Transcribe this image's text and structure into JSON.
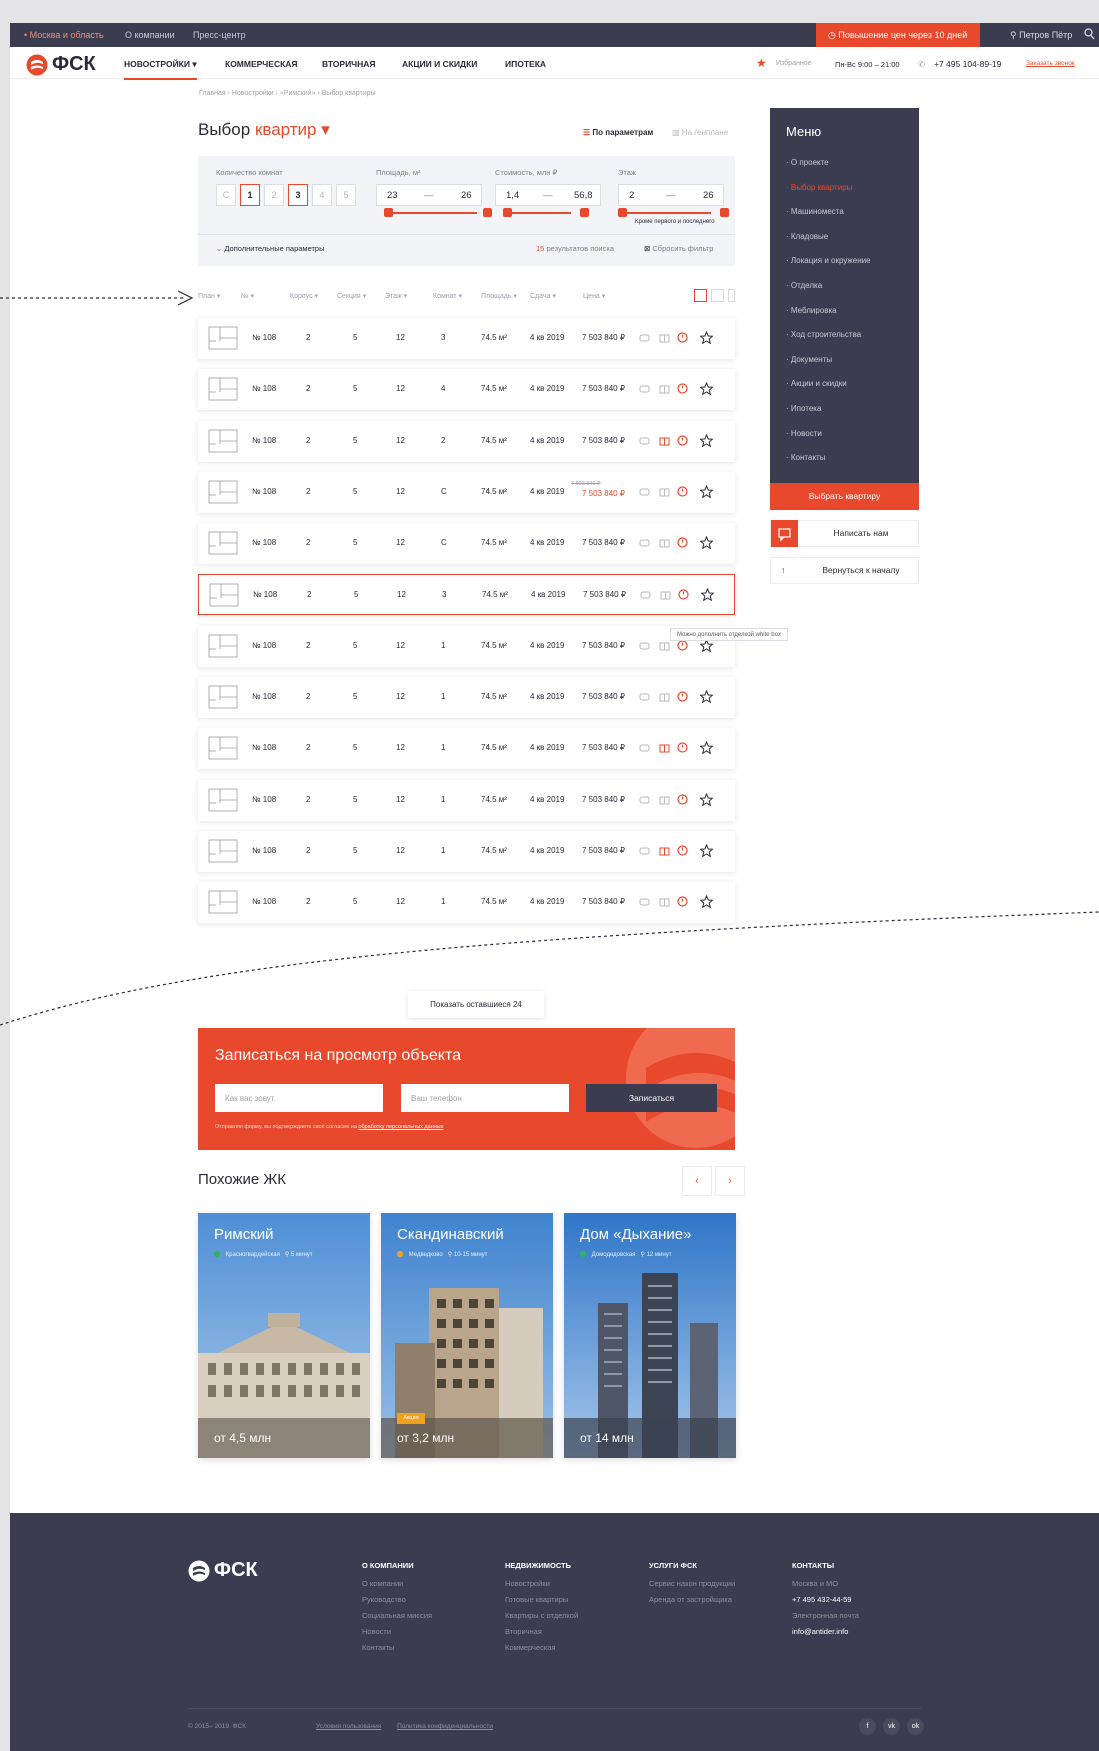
{
  "topbar": {
    "region": "• Москва и область",
    "about": "О компании",
    "press": "Пресс-центр",
    "promo": "Повышение цен через 10 дней",
    "user": "Петров Пётр"
  },
  "nav": {
    "items": [
      "НОВОСТРОЙКИ ▾",
      "КОММЕРЧЕСКАЯ",
      "ВТОРИЧНАЯ",
      "АКЦИИ И СКИДКИ",
      "ИПОТЕКА"
    ],
    "favorites": "Избранное",
    "hours": "Пн-Вс 9:00 – 21:00",
    "phone": "+7 495 104-89-19",
    "callback": "Заказать звонок"
  },
  "brand": {
    "logo_text": "ФСК",
    "accent_color": "#e8482c",
    "dark_color": "#3b3c4f"
  },
  "breadcrumb": "Главная  ›  Новостройки  ›  «Римский»  ›  Выбор квартиры",
  "title": {
    "prefix": "Выбор",
    "accent": "квартир ▾"
  },
  "modes": {
    "params": "По параметрам",
    "plan": "На генплане"
  },
  "filter": {
    "rooms_label": "Количество комнат",
    "rooms": [
      "С",
      "1",
      "2",
      "3",
      "4",
      "5"
    ],
    "area_label": "Площадь, м²",
    "area_from": "23",
    "area_to": "26",
    "price_label": "Стоимость, млн ₽",
    "price_from": "1,4",
    "price_to": "56,8",
    "floor_label": "Этаж",
    "floor_from": "2",
    "floor_to": "26",
    "dash": "—",
    "floor_note": "Кроме первого и последнего",
    "extra": "Дополнительные параметры",
    "results_count": "15",
    "results_text": "результатов поиска",
    "reset": "Сбросить фильтр"
  },
  "table": {
    "headers": [
      "План ▾",
      "№ ▾",
      "Корпус ▾",
      "Секция ▾",
      "Этаж ▾",
      "Комнат ▾",
      "Площадь ▾",
      "Сдача ▾",
      "Цена ▾"
    ],
    "rows": [
      {
        "num": "№ 108",
        "corp": "2",
        "sec": "5",
        "floor": "12",
        "rooms": "3",
        "area": "74.5 м²",
        "date": "4 кв 2019",
        "price": "7 503 840 ₽"
      },
      {
        "num": "№ 108",
        "corp": "2",
        "sec": "5",
        "floor": "12",
        "rooms": "4",
        "area": "74.5 м²",
        "date": "4 кв 2019",
        "price": "7 503 840 ₽"
      },
      {
        "num": "№ 108",
        "corp": "2",
        "sec": "5",
        "floor": "12",
        "rooms": "2",
        "area": "74.5 м²",
        "date": "4 кв 2019",
        "price": "7 503 840 ₽"
      },
      {
        "num": "№ 108",
        "corp": "2",
        "sec": "5",
        "floor": "12",
        "rooms": "С",
        "area": "74.5 м²",
        "date": "4 кв 2019",
        "price": "7 503 840 ₽",
        "old_price": "7 503 840 ₽"
      },
      {
        "num": "№ 108",
        "corp": "2",
        "sec": "5",
        "floor": "12",
        "rooms": "С",
        "area": "74.5 м²",
        "date": "4 кв 2019",
        "price": "7 503 840 ₽"
      },
      {
        "num": "№ 108",
        "corp": "2",
        "sec": "5",
        "floor": "12",
        "rooms": "3",
        "area": "74.5 м²",
        "date": "4 кв 2019",
        "price": "7 503 840 ₽"
      },
      {
        "num": "№ 108",
        "corp": "2",
        "sec": "5",
        "floor": "12",
        "rooms": "1",
        "area": "74.5 м²",
        "date": "4 кв 2019",
        "price": "7 503 840 ₽"
      },
      {
        "num": "№ 108",
        "corp": "2",
        "sec": "5",
        "floor": "12",
        "rooms": "1",
        "area": "74.5 м²",
        "date": "4 кв 2019",
        "price": "7 503 840 ₽"
      },
      {
        "num": "№ 108",
        "corp": "2",
        "sec": "5",
        "floor": "12",
        "rooms": "1",
        "area": "74.5 м²",
        "date": "4 кв 2019",
        "price": "7 503 840 ₽"
      },
      {
        "num": "№ 108",
        "corp": "2",
        "sec": "5",
        "floor": "12",
        "rooms": "1",
        "area": "74.5 м²",
        "date": "4 кв 2019",
        "price": "7 503 840 ₽"
      },
      {
        "num": "№ 108",
        "corp": "2",
        "sec": "5",
        "floor": "12",
        "rooms": "1",
        "area": "74.5 м²",
        "date": "4 кв 2019",
        "price": "7 503 840 ₽"
      },
      {
        "num": "№ 108",
        "corp": "2",
        "sec": "5",
        "floor": "12",
        "rooms": "1",
        "area": "74.5 м²",
        "date": "4 кв 2019",
        "price": "7 503 840 ₽"
      }
    ],
    "tooltip": "Можно дополнить отделкой white box",
    "show_more": "Показать оставшиеся 24"
  },
  "side_menu": {
    "title": "Меню",
    "items": [
      "О проекте",
      "Выбор квартиры",
      "Машиноместа",
      "Кладовые",
      "Локация и окружение",
      "Отделка",
      "Меблировка",
      "Ход строительства",
      "Документы",
      "Акции и скидки",
      "Ипотека",
      "Новости",
      "Контакты"
    ],
    "cta": "Выбрать квартиру",
    "write": "Написать нам",
    "back": "Вернуться к началу"
  },
  "booking": {
    "title": "Записаться на просмотр объекта",
    "name_placeholder": "Как вас зовут",
    "phone_placeholder": "Ваш телефон",
    "submit": "Записаться",
    "consent_text": "Отправляя форму, вы подтверждаете своё согласие на",
    "consent_link": "обработку персональных данных"
  },
  "similar": {
    "title": "Похожие ЖК",
    "prev": "‹",
    "next": "›",
    "cards": [
      {
        "name": "Римский",
        "metro": "Красногвардейская",
        "time": "5 минут",
        "price": "от 4,5 млн",
        "metro_color": "#2fb45a"
      },
      {
        "name": "Скандинавский",
        "metro": "Медведково",
        "time": "10-15 минут",
        "price": "от 3,2 млн",
        "metro_color": "#f0a21c",
        "badge": "Акция"
      },
      {
        "name": "Дом «Дыхание»",
        "metro": "Домодедовская",
        "time": "12 минут",
        "price": "от 14 млн",
        "metro_color": "#2fb45a"
      }
    ]
  },
  "footer": {
    "logo_text": "ФСК",
    "col1": {
      "title": "О КОМПАНИИ",
      "items": [
        "О компании",
        "Руководство",
        "Социальная миссия",
        "Новости",
        "Контакты"
      ]
    },
    "col2": {
      "title": "НЕДВИЖИМОСТЬ",
      "items": [
        "Новостройки",
        "Готовые квартиры",
        "Квартиры с отделкой",
        "Вторичная",
        "Коммерческая"
      ]
    },
    "col3": {
      "title": "УСЛУГИ ФСК",
      "items": [
        "Сервис након продукции",
        "Аренда от застройщика"
      ]
    },
    "col4": {
      "title": "КОНТАКТЫ",
      "region": "Москва и МО",
      "phone": "+7 495 432-44-59",
      "mail_label": "Электронная почта",
      "mail": "info@antider.info"
    },
    "copyright": "© 2015– 2019. ФСК",
    "links": [
      "Условия пользования",
      "Политика конфиденциальности"
    ],
    "social": [
      "f",
      "vk",
      "ok"
    ]
  }
}
